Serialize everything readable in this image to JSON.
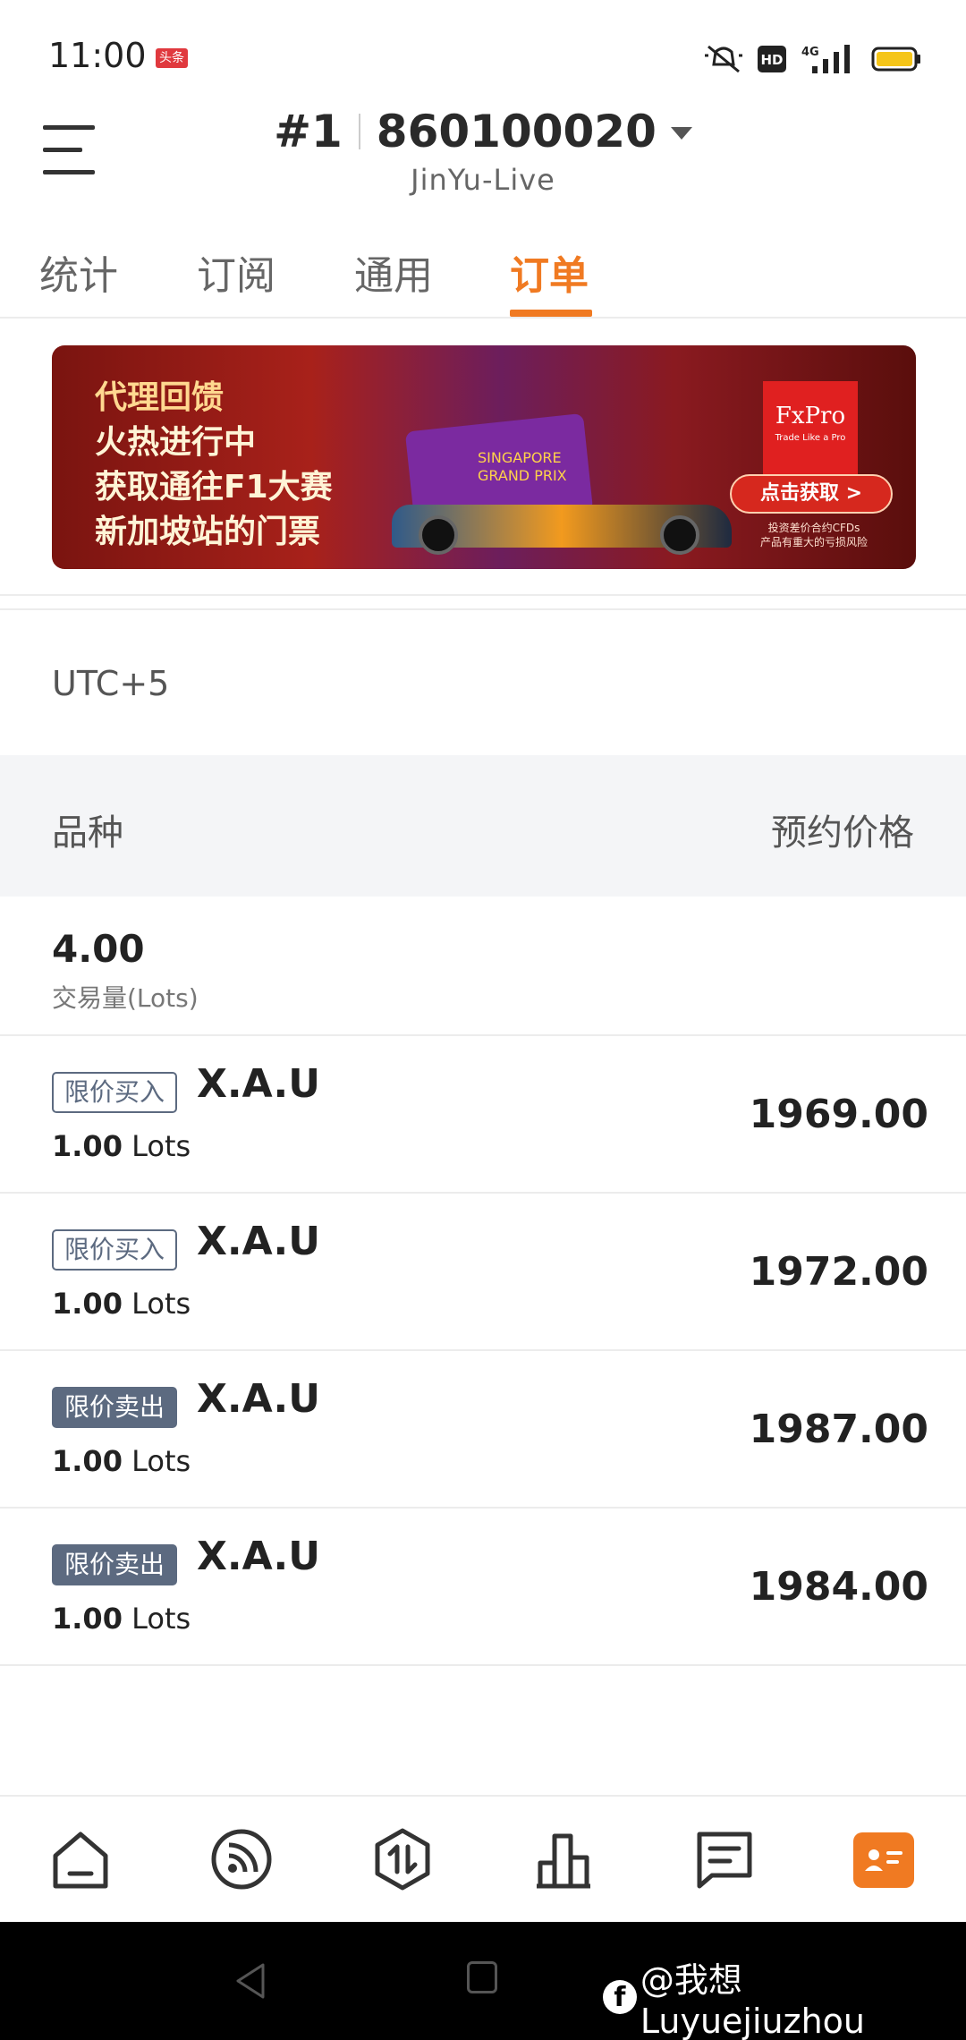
{
  "status_bar": {
    "time": "11:00",
    "badge": "头条",
    "icons": [
      "mute-icon",
      "hd-icon",
      "4g-signal-icon",
      "battery-icon"
    ],
    "network": "4G"
  },
  "header": {
    "account_index": "#1",
    "account_number": "860100020",
    "server": "JinYu-Live"
  },
  "tabs": [
    {
      "label": "统计",
      "active": false
    },
    {
      "label": "订阅",
      "active": false
    },
    {
      "label": "通用",
      "active": false
    },
    {
      "label": "订单",
      "active": true
    }
  ],
  "banner": {
    "headline": [
      "代理回馈",
      "火热进行中",
      "获取通往F1大赛",
      "新加坡站的门票"
    ],
    "ticket_text": [
      "SINGAPORE",
      "GRAND PRIX"
    ],
    "logo": "FxPro",
    "logo_tagline": "Trade Like a Pro",
    "cta": "点击获取 >",
    "risk_notice": [
      "投资差价合约CFDs",
      "产品有重大的亏损风险"
    ]
  },
  "timezone": "UTC+5",
  "table": {
    "col_symbol": "品种",
    "col_price": "预约价格"
  },
  "summary": {
    "total_volume": "4.00",
    "volume_label": "交易量(Lots)"
  },
  "orders": [
    {
      "type": "限价买入",
      "side": "buy",
      "symbol": "X.A.U",
      "lots": "1.00",
      "lots_unit": "Lots",
      "price": "1969.00"
    },
    {
      "type": "限价买入",
      "side": "buy",
      "symbol": "X.A.U",
      "lots": "1.00",
      "lots_unit": "Lots",
      "price": "1972.00"
    },
    {
      "type": "限价卖出",
      "side": "sell",
      "symbol": "X.A.U",
      "lots": "1.00",
      "lots_unit": "Lots",
      "price": "1987.00"
    },
    {
      "type": "限价卖出",
      "side": "sell",
      "symbol": "X.A.U",
      "lots": "1.00",
      "lots_unit": "Lots",
      "price": "1984.00"
    }
  ],
  "bottom_nav": [
    {
      "icon": "home-icon",
      "active": false
    },
    {
      "icon": "feed-icon",
      "active": false
    },
    {
      "icon": "trade-icon",
      "active": false
    },
    {
      "icon": "chart-icon",
      "active": false
    },
    {
      "icon": "message-icon",
      "active": false
    },
    {
      "icon": "account-icon",
      "active": true
    }
  ],
  "watermark": "@我想Luyuejiuzhou",
  "colors": {
    "accent": "#f07a22",
    "tag": "#5c6a80"
  }
}
